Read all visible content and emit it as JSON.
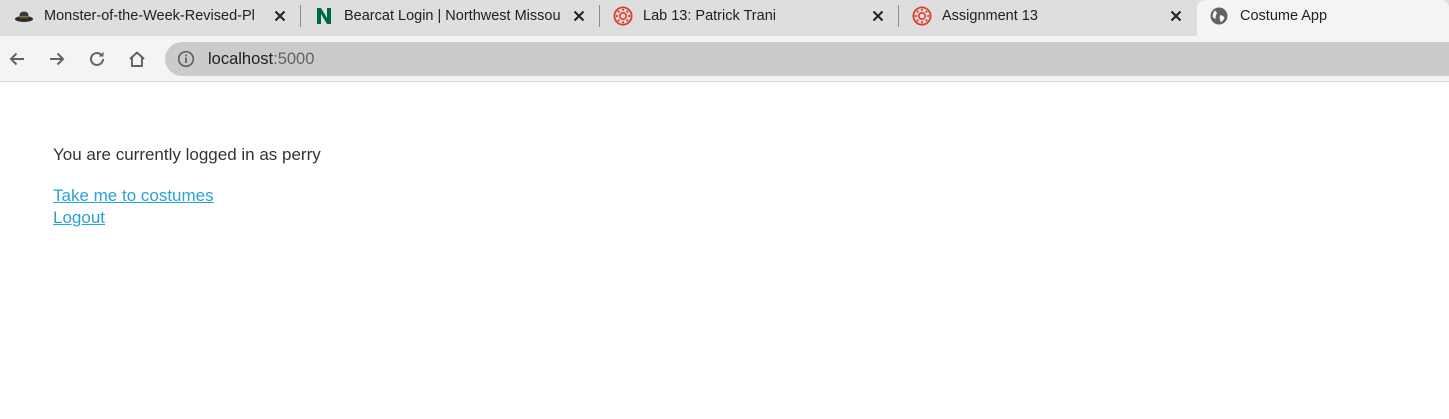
{
  "browser": {
    "tabs": [
      {
        "title": "Monster-of-the-Week-Revised-Pl",
        "icon": "hat-icon",
        "active": false
      },
      {
        "title": "Bearcat Login | Northwest Missou",
        "icon": "northwest-n-icon",
        "active": false
      },
      {
        "title": "Lab 13: Patrick Trani",
        "icon": "canvas-icon",
        "active": false
      },
      {
        "title": "Assignment 13",
        "icon": "canvas-icon",
        "active": false
      },
      {
        "title": "Costume App",
        "icon": "globe-icon",
        "active": true
      }
    ],
    "address": {
      "host": "localhost",
      "port": ":5000"
    }
  },
  "page": {
    "status_text": "You are currently logged in as perry",
    "links": [
      {
        "label": "Take me to costumes"
      },
      {
        "label": "Logout"
      }
    ]
  },
  "colors": {
    "link": "#29a3d6",
    "canvas_red": "#e03c31",
    "northwest_green": "#006747"
  }
}
